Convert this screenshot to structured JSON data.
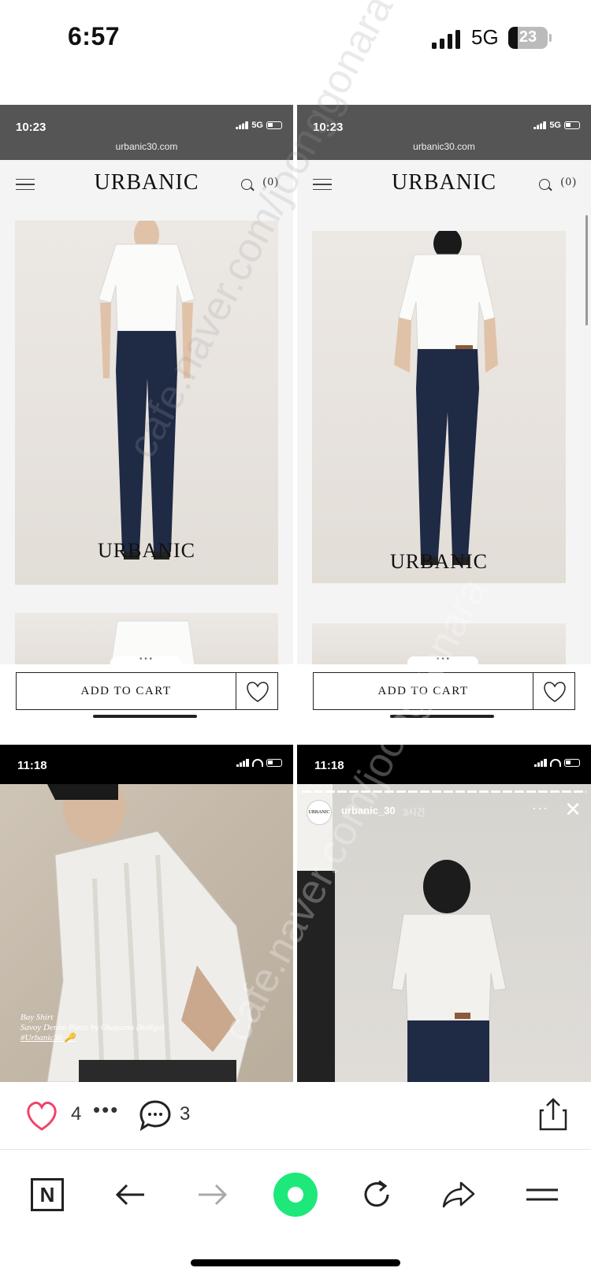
{
  "status_bar": {
    "time": "6:57",
    "network": "5G",
    "battery": "23"
  },
  "panels": {
    "shop_left": {
      "time": "10:23",
      "network": "5G",
      "url": "urbanic30.com",
      "logo": "URBANIC",
      "cart_count": "(0)",
      "photo_logo": "URBANIC",
      "add_to_cart": "ADD TO CART"
    },
    "shop_right": {
      "time": "10:23",
      "network": "5G",
      "url": "urbanic30.com",
      "logo": "URBANIC",
      "cart_count": "(0)",
      "photo_logo": "URBANIC",
      "add_to_cart": "ADD TO CART"
    },
    "story_left": {
      "time": "11:18",
      "caption_line1": "Bay Shirt",
      "caption_line2": "Savoy Denim Pants by Okayama (Indigo)",
      "caption_tag": "#Urbanic30 🔑"
    },
    "story_right": {
      "time": "11:18",
      "avatar_text": "URBANIC",
      "username": "urbanic_30",
      "time_ago": "3시간",
      "more": "···",
      "close": "✕"
    }
  },
  "actions": {
    "like_count": "4",
    "more": "•••",
    "comment_count": "3"
  },
  "nav": {
    "naver_label": "N"
  },
  "watermark": "cafe.naver.com/joonggonara",
  "colors": {
    "like": "#f0436a",
    "green": "#1ee87a"
  }
}
